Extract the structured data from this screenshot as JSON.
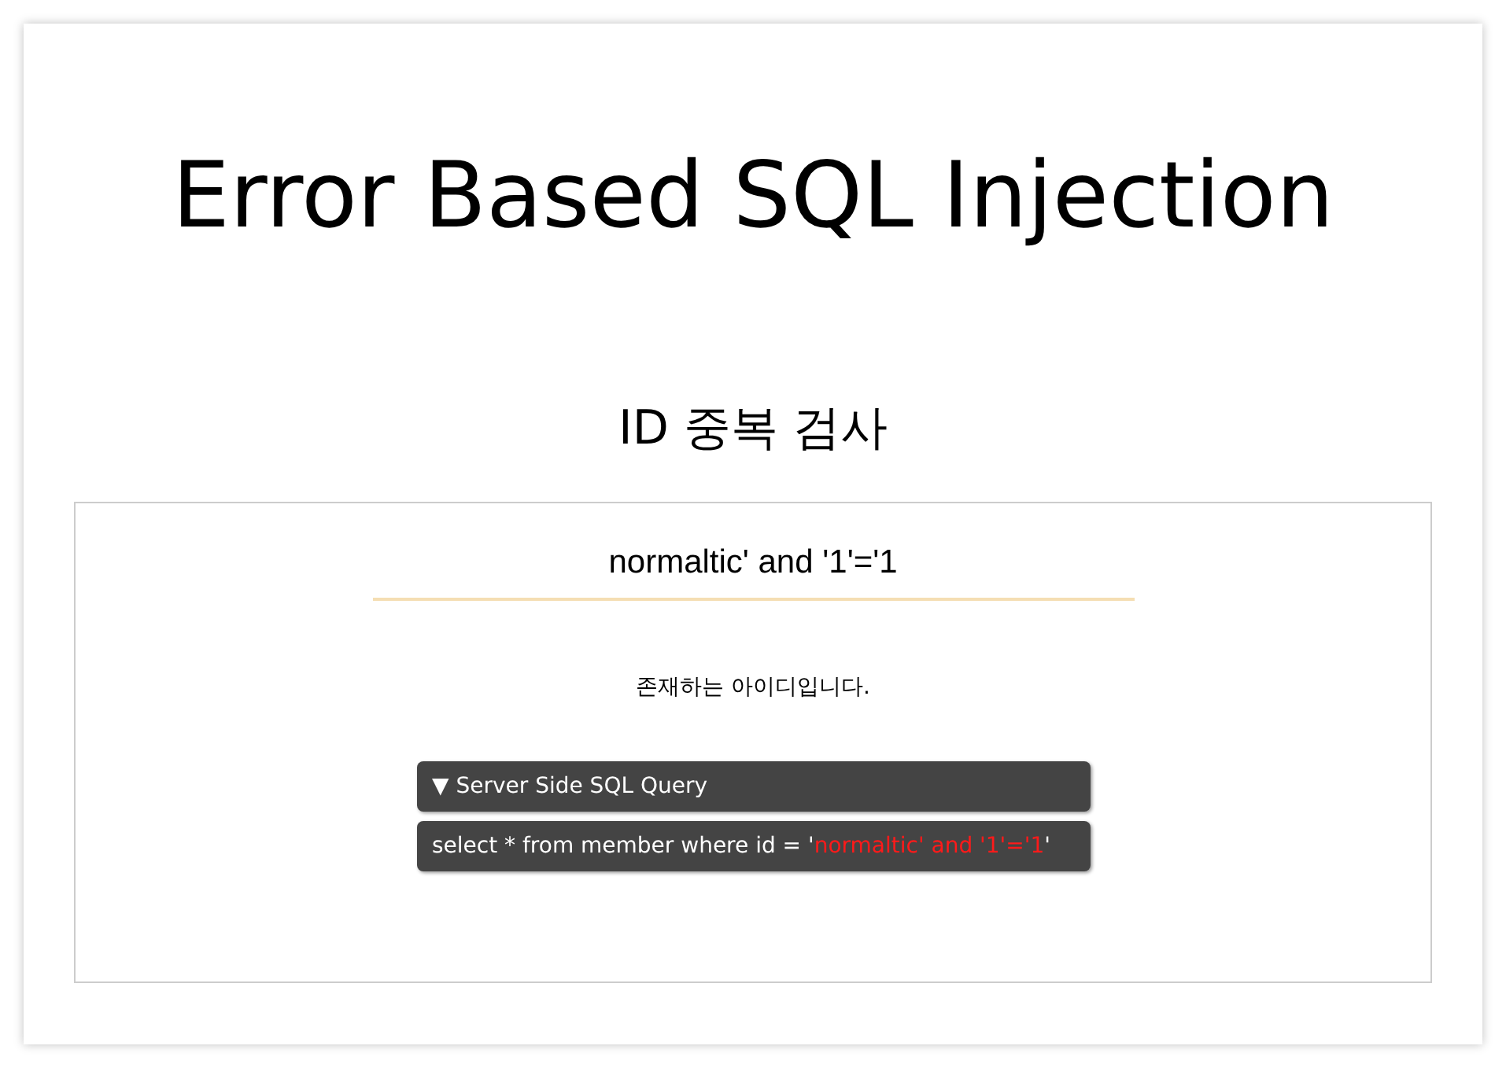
{
  "page": {
    "title": "Error Based SQL Injection",
    "subtitle": "ID 중복 검사"
  },
  "form": {
    "input_value": "normaltic' and '1'='1",
    "result_message": "존재하는 아이디입니다."
  },
  "query_panel": {
    "toggle_icon": "▼",
    "label": "Server Side SQL Query",
    "query_parts": [
      {
        "text": "select * from member where id = '",
        "highlight": false
      },
      {
        "text": "normaltic' and '1'='1",
        "highlight": true
      },
      {
        "text": "'",
        "highlight": false
      }
    ]
  }
}
